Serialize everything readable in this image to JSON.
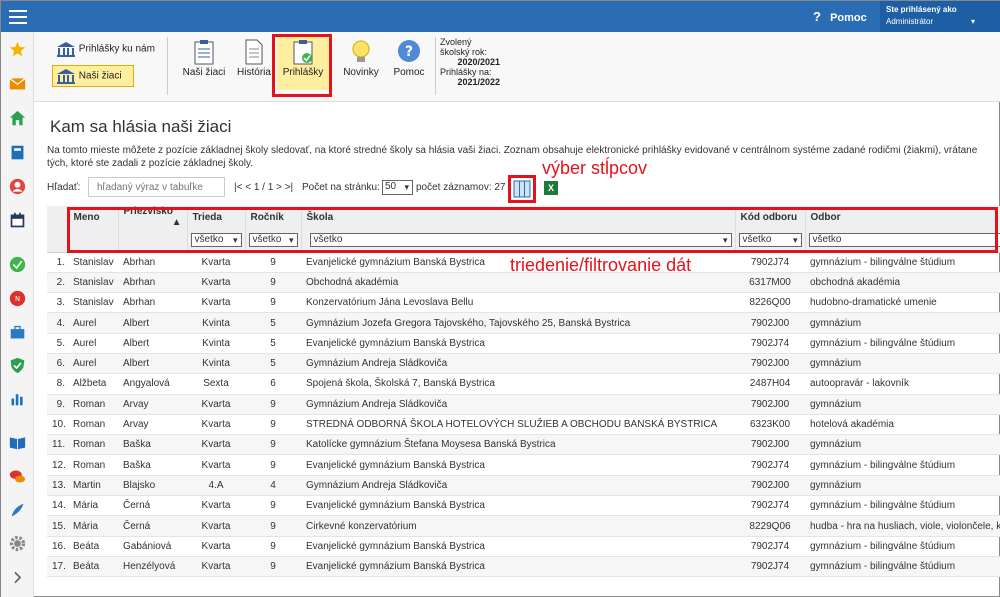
{
  "header": {
    "help_label": "Pomoc",
    "user_label": "Ste prihlásený ako",
    "user_role": "Administrátor"
  },
  "sidebar": {
    "icons": [
      "star-icon",
      "mail-icon",
      "home-icon",
      "book-icon",
      "person-icon",
      "calendar-icon",
      "check-icon",
      "badge-icon",
      "briefcase-icon",
      "shield-check-icon",
      "bar-chart-icon",
      "open-book-icon",
      "chat-icon",
      "feather-icon",
      "gear-icon",
      "chevron-right-icon"
    ]
  },
  "ribbon": {
    "prihlasky_ku_nam": "Prihlášky ku nám",
    "nasi_ziaci_left": "Naši žiaci",
    "nasi_ziaci": "Naši žiaci",
    "historia": "História",
    "prihlasky": "Prihlášky",
    "novinky": "Novinky",
    "pomoc": "Pomoc",
    "year_l1": "Zvolený",
    "year_l2": "školský rok:",
    "year_val": "2020/2021",
    "prih_l1": "Prihlášky na:",
    "prih_val": "2021/2022"
  },
  "page": {
    "title": "Kam sa hlásia naši žiaci",
    "description": "Na tomto mieste môžete z pozície základnej školy sledovať, na ktoré stredné školy sa hlásia vaši žiaci. Zoznam obsahuje elektronické prihlášky evidované v centrálnom systéme zadané rodičmi (žiakmi), vrátane tých, ktoré ste zadali z pozície základnej školy."
  },
  "toolbar": {
    "search_label": "Hľadať:",
    "search_placeholder": "hľadaný výraz v tabuľke",
    "pager": "|< < 1 / 1 > >|",
    "per_page_label": "Počet na stránku:",
    "per_page": "50",
    "count_label": "počet záznamov: 27",
    "export_label": "X"
  },
  "annotations": {
    "columns": "výber stĺpcov",
    "filter": "triedenie/filtrovanie dát"
  },
  "table": {
    "headers": [
      "Meno",
      "Priezvisko",
      "Trieda",
      "Ročník",
      "Škola",
      "Kód odboru",
      "Odbor"
    ],
    "sort_indicator": "▲",
    "filters": [
      "všetko",
      "všetko",
      "všetko",
      "všetko",
      "všetko"
    ],
    "rows": [
      [
        "1.",
        "Stanislav",
        "Abrhan",
        "Kvarta",
        "9",
        "Evanjelické gymnázium Banská Bystrica",
        "7902J74",
        "gymnázium - bilingválne štúdium"
      ],
      [
        "2.",
        "Stanislav",
        "Abrhan",
        "Kvarta",
        "9",
        "Obchodná akadémia",
        "6317M00",
        "obchodná akadémia"
      ],
      [
        "3.",
        "Stanislav",
        "Abrhan",
        "Kvarta",
        "9",
        "Konzervatórium Jána Levoslava Bellu",
        "8226Q00",
        "hudobno-dramatické umenie"
      ],
      [
        "4.",
        "Aurel",
        "Albert",
        "Kvinta",
        "5",
        "Gymnázium Jozefa Gregora Tajovského, Tajovského 25, Banská Bystrica",
        "7902J00",
        "gymnázium"
      ],
      [
        "5.",
        "Aurel",
        "Albert",
        "Kvinta",
        "5",
        "Evanjelické gymnázium Banská Bystrica",
        "7902J74",
        "gymnázium - bilingválne štúdium"
      ],
      [
        "6.",
        "Aurel",
        "Albert",
        "Kvinta",
        "5",
        "Gymnázium Andreja Sládkoviča",
        "7902J00",
        "gymnázium"
      ],
      [
        "8.",
        "Alžbeta",
        "Angyalová",
        "Sexta",
        "6",
        "Spojená škola, Školská 7, Banská Bystrica",
        "2487H04",
        "autoopravár - lakovník"
      ],
      [
        "9.",
        "Roman",
        "Arvay",
        "Kvarta",
        "9",
        "Gymnázium Andreja Sládkoviča",
        "7902J00",
        "gymnázium"
      ],
      [
        "10.",
        "Roman",
        "Arvay",
        "Kvarta",
        "9",
        "STREDNÁ ODBORNÁ ŠKOLA HOTELOVÝCH SLUŽIEB A OBCHODU BANSKÁ BYSTRICA",
        "6323K00",
        "hotelová akadémia"
      ],
      [
        "11.",
        "Roman",
        "Baška",
        "Kvarta",
        "9",
        "Katolícke gymnázium Štefana Moysesa Banská Bystrica",
        "7902J00",
        "gymnázium"
      ],
      [
        "12.",
        "Roman",
        "Baška",
        "Kvarta",
        "9",
        "Evanjelické gymnázium Banská Bystrica",
        "7902J74",
        "gymnázium - bilingválne štúdium"
      ],
      [
        "13.",
        "Martin",
        "Blajsko",
        "4.A",
        "4",
        "Gymnázium Andreja Sládkoviča",
        "7902J00",
        "gymnázium"
      ],
      [
        "14.",
        "Mária",
        "Černá",
        "Kvarta",
        "9",
        "Evanjelické gymnázium Banská Bystrica",
        "7902J74",
        "gymnázium - bilingválne štúdium"
      ],
      [
        "15.",
        "Mária",
        "Černá",
        "Kvarta",
        "9",
        "Cirkevné konzervatórium",
        "8229Q06",
        "hudba - hra na husliach, viole, violončele, kontrabase"
      ],
      [
        "16.",
        "Beáta",
        "Gabániová",
        "Kvarta",
        "9",
        "Evanjelické gymnázium Banská Bystrica",
        "7902J74",
        "gymnázium - bilingválne štúdium"
      ],
      [
        "17.",
        "Beáta",
        "Henzélyová",
        "Kvarta",
        "9",
        "Evanjelické gymnázium Banská Bystrica",
        "7902J74",
        "gymnázium - bilingválne štúdium"
      ]
    ]
  }
}
